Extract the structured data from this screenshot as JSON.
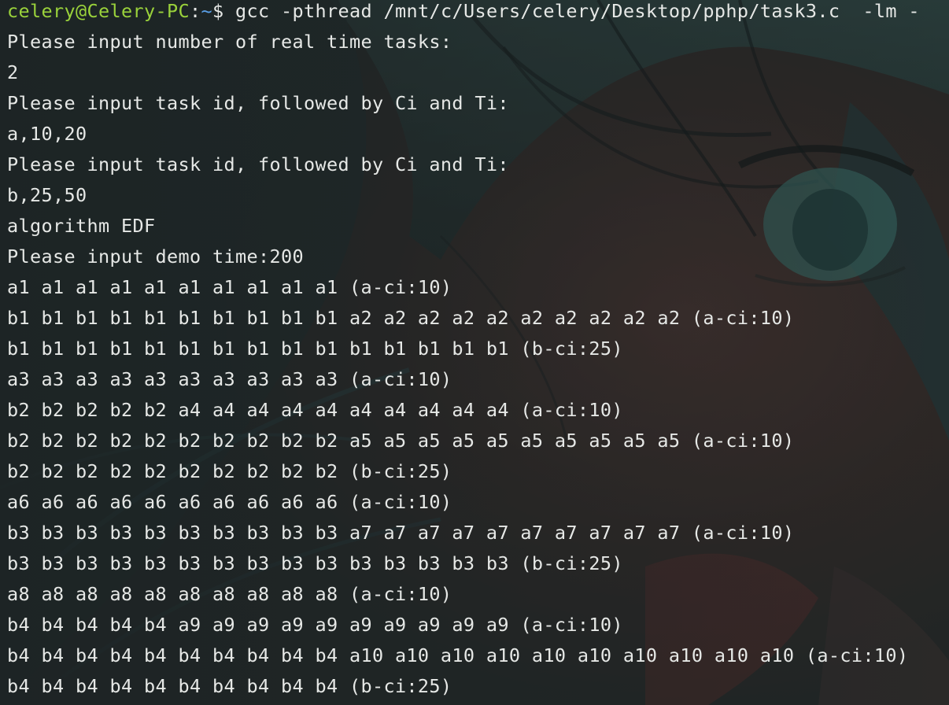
{
  "terminal": {
    "prompt": {
      "user_host": "celery@Celery-PC",
      "separator": ":",
      "path": "~",
      "symbol": "$",
      "command": " gcc -pthread /mnt/c/Users/celery/Desktop/pphp/task3.c  -lm -"
    },
    "lines": [
      "Please input number of real time tasks:",
      "2",
      "Please input task id, followed by Ci and Ti:",
      "a,10,20",
      "Please input task id, followed by Ci and Ti:",
      "b,25,50",
      "algorithm EDF",
      "Please input demo time:200",
      "a1 a1 a1 a1 a1 a1 a1 a1 a1 a1 (a-ci:10)",
      "b1 b1 b1 b1 b1 b1 b1 b1 b1 b1 a2 a2 a2 a2 a2 a2 a2 a2 a2 a2 (a-ci:10)",
      "b1 b1 b1 b1 b1 b1 b1 b1 b1 b1 b1 b1 b1 b1 b1 (b-ci:25)",
      "a3 a3 a3 a3 a3 a3 a3 a3 a3 a3 (a-ci:10)",
      "b2 b2 b2 b2 b2 a4 a4 a4 a4 a4 a4 a4 a4 a4 a4 (a-ci:10)",
      "b2 b2 b2 b2 b2 b2 b2 b2 b2 b2 a5 a5 a5 a5 a5 a5 a5 a5 a5 a5 (a-ci:10)",
      "b2 b2 b2 b2 b2 b2 b2 b2 b2 b2 (b-ci:25)",
      "a6 a6 a6 a6 a6 a6 a6 a6 a6 a6 (a-ci:10)",
      "b3 b3 b3 b3 b3 b3 b3 b3 b3 b3 a7 a7 a7 a7 a7 a7 a7 a7 a7 a7 (a-ci:10)",
      "b3 b3 b3 b3 b3 b3 b3 b3 b3 b3 b3 b3 b3 b3 b3 (b-ci:25)",
      "a8 a8 a8 a8 a8 a8 a8 a8 a8 a8 (a-ci:10)",
      "b4 b4 b4 b4 b4 a9 a9 a9 a9 a9 a9 a9 a9 a9 a9 (a-ci:10)",
      "b4 b4 b4 b4 b4 b4 b4 b4 b4 b4 a10 a10 a10 a10 a10 a10 a10 a10 a10 a10 (a-ci:10)",
      "b4 b4 b4 b4 b4 b4 b4 b4 b4 b4 (b-ci:25)"
    ]
  }
}
